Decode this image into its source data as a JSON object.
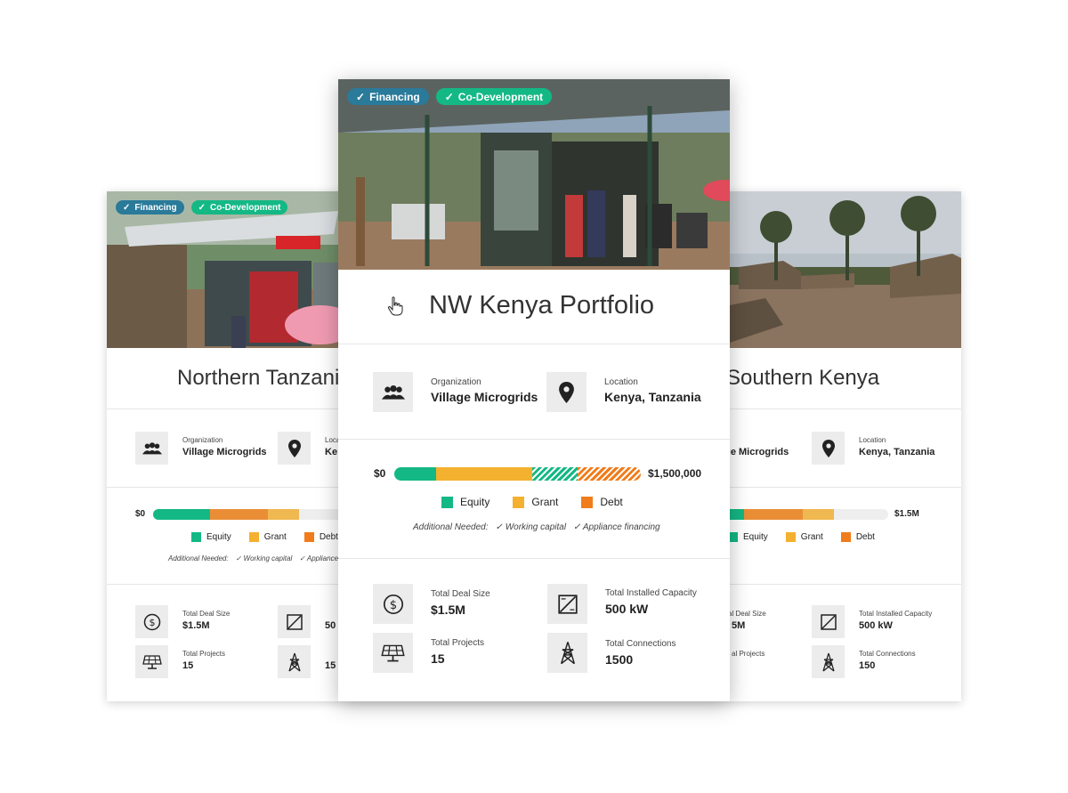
{
  "badges": {
    "financing": "Financing",
    "codev": "Co-Development",
    "check": "✓"
  },
  "colors": {
    "equity": "#14b884",
    "grant": "#f4b02f",
    "debt": "#f07c1b",
    "debt_alt": "#ea8e36",
    "grant_alt": "#f0b851",
    "track": "#eeeeee",
    "financing": "#2a7a9a",
    "codev": "#14b884"
  },
  "labels": {
    "organization": "Organization",
    "location": "Location",
    "additional_needed": "Additional Needed:",
    "total_deal_size": "Total Deal Size",
    "total_installed_capacity": "Total Installed Capacity",
    "total_projects": "Total Projects",
    "total_connections": "Total Connections",
    "legend_equity": "Equity",
    "legend_grant": "Grant",
    "legend_debt": "Debt"
  },
  "icons": [
    "people-icon",
    "location-pin-icon",
    "dollar-icon",
    "solar-panel-icon",
    "capacity-meter-icon",
    "transmission-tower-icon",
    "hand-cursor-icon"
  ],
  "cards": {
    "center": {
      "title": "NW Kenya Portfolio",
      "organization": "Village Microgrids",
      "location": "Kenya, Tanzania",
      "bar_min": "$0",
      "bar_max": "$1,500,000",
      "equity_fraction": 0.17,
      "grant_fraction": 0.39,
      "debt_fraction": 0.44,
      "needs": [
        "Working capital",
        "Appliance financing"
      ],
      "deal_size": "$1.5M",
      "installed_capacity": "500 kW",
      "projects": "15",
      "connections": "1500"
    },
    "left": {
      "title": "Northern Tanzania",
      "organization": "Village Microgrids",
      "location_partial": "Ke",
      "bar_min": "$0",
      "needs": [
        "Working capital",
        "Appliance"
      ],
      "deal_size": "$1.5M",
      "installed_capacity_partial": "50",
      "projects": "15",
      "connections_partial": "15"
    },
    "right": {
      "title": "Southern Kenya",
      "organization_partial": "age Microgrids",
      "location": "Kenya, Tanzania",
      "bar_max": "$1.5M",
      "deal_size_partial": "5M",
      "deal_label_partial": "al Deal Size",
      "projects_label_partial": "al Projects",
      "installed_capacity": "500 kW",
      "connections": "150"
    }
  }
}
